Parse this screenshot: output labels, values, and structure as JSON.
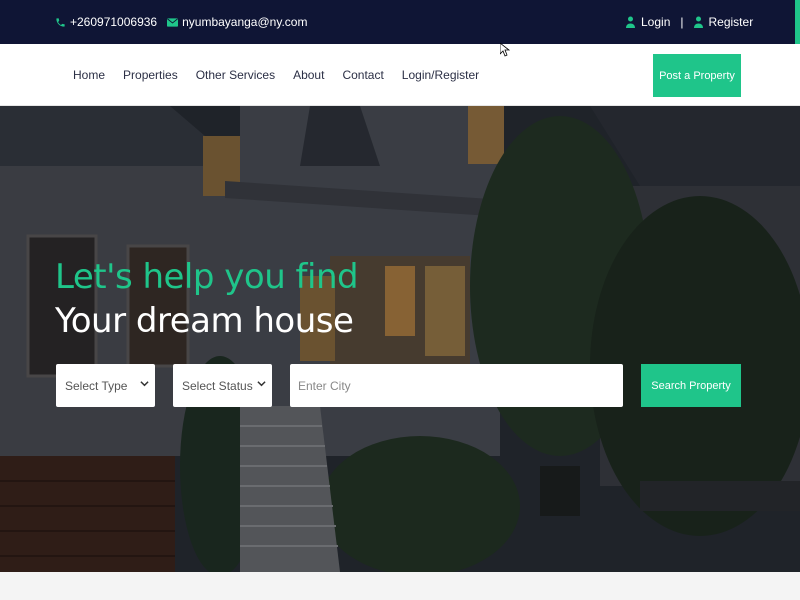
{
  "topbar": {
    "phone": "+260971006936",
    "email": "nyumbayanga@ny.com",
    "login_label": "Login",
    "separator": "|",
    "register_label": "Register"
  },
  "nav": {
    "items": [
      {
        "label": "Home"
      },
      {
        "label": "Properties"
      },
      {
        "label": "Other Services"
      },
      {
        "label": "About"
      },
      {
        "label": "Contact"
      },
      {
        "label": "Login/Register"
      }
    ],
    "cta_label": "Post a Property"
  },
  "hero": {
    "headline_line1": "Let's help you find",
    "headline_line2": "Your dream house",
    "type_select": {
      "selected": "Select Type"
    },
    "status_select": {
      "selected": "Select Status"
    },
    "city_placeholder": "Enter City",
    "search_button": "Search Property"
  },
  "colors": {
    "accent": "#1fc58a",
    "topbar_bg": "#0f1535",
    "nav_text": "#2b2f45"
  },
  "icons": {
    "phone": "phone-icon",
    "email": "mail-icon",
    "user": "user-icon",
    "select": "chevron-down-icon"
  }
}
